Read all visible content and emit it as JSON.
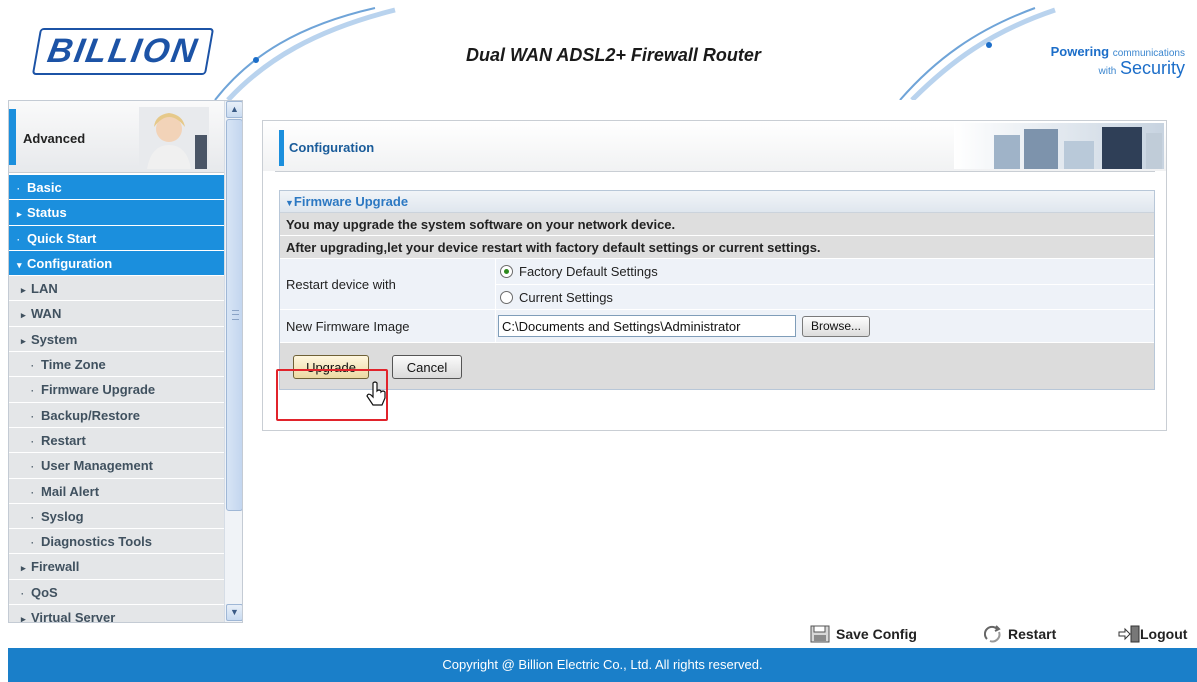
{
  "header": {
    "logo": "BILLION",
    "product_title": "Dual WAN ADSL2+ Firewall Router",
    "tagline_powering": "Powering",
    "tagline_communications": "communications",
    "tagline_with": "with",
    "tagline_security": "Security"
  },
  "sidebar": {
    "banner_label": "Advanced",
    "items": [
      {
        "label": "Basic",
        "level": "top",
        "marker": "·"
      },
      {
        "label": "Status",
        "level": "top",
        "marker": "▸"
      },
      {
        "label": "Quick Start",
        "level": "top",
        "marker": "·"
      },
      {
        "label": "Configuration",
        "level": "top",
        "marker": "▾"
      },
      {
        "label": "LAN",
        "level": "sub",
        "marker": "▸"
      },
      {
        "label": "WAN",
        "level": "sub",
        "marker": "▸"
      },
      {
        "label": "System",
        "level": "sub",
        "marker": "▸"
      },
      {
        "label": "Time Zone",
        "level": "leaf",
        "marker": "·"
      },
      {
        "label": "Firmware Upgrade",
        "level": "leaf",
        "marker": "·"
      },
      {
        "label": "Backup/Restore",
        "level": "leaf",
        "marker": "·"
      },
      {
        "label": "Restart",
        "level": "leaf",
        "marker": "·"
      },
      {
        "label": "User Management",
        "level": "leaf",
        "marker": "·"
      },
      {
        "label": "Mail Alert",
        "level": "leaf",
        "marker": "·"
      },
      {
        "label": "Syslog",
        "level": "leaf",
        "marker": "·"
      },
      {
        "label": "Diagnostics Tools",
        "level": "leaf",
        "marker": "·"
      },
      {
        "label": "Firewall",
        "level": "sub",
        "marker": "▸"
      },
      {
        "label": "QoS",
        "level": "sub",
        "marker": "·"
      },
      {
        "label": "Virtual Server",
        "level": "sub",
        "marker": "▸"
      }
    ]
  },
  "panel": {
    "title": "Configuration",
    "section_title": "Firmware Upgrade",
    "info_line_1": "You may upgrade the system software on your network device.",
    "info_line_2": "After upgrading,let your device restart with factory default settings or current settings.",
    "restart_label": "Restart device with",
    "restart_options": [
      "Factory Default Settings",
      "Current Settings"
    ],
    "restart_selected": "Factory Default Settings",
    "firmware_label": "New Firmware Image",
    "firmware_path": "C:\\Documents and Settings\\Administrator",
    "browse_label": "Browse...",
    "upgrade_label": "Upgrade",
    "cancel_label": "Cancel"
  },
  "actions": {
    "save_config": "Save Config",
    "restart": "Restart",
    "logout": "Logout"
  },
  "footer": {
    "copyright": "Copyright @ Billion Electric Co., Ltd. All rights reserved."
  },
  "colors": {
    "brand_blue": "#1b8fdd",
    "footer_blue": "#1a7fc9",
    "highlight_red": "#e1232b"
  }
}
